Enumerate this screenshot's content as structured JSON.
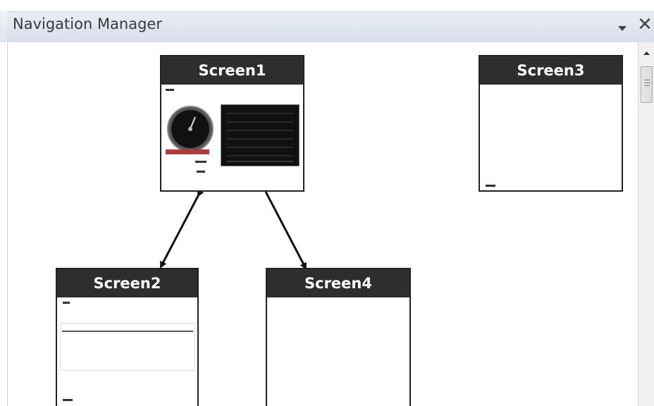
{
  "window": {
    "title": "Navigation Manager",
    "pin_icon": "dropdown-pin-icon",
    "close_glyph": "✕"
  },
  "screens": [
    {
      "id": "screen1",
      "label": "Screen1"
    },
    {
      "id": "screen2",
      "label": "Screen2"
    },
    {
      "id": "screen3",
      "label": "Screen3"
    },
    {
      "id": "screen4",
      "label": "Screen4"
    }
  ],
  "links": [
    {
      "from": "Screen1",
      "to": "Screen2",
      "direction": "both"
    },
    {
      "from": "Screen1",
      "to": "Screen4",
      "direction": "forward"
    }
  ],
  "colors": {
    "node_header": "#2e2e2e",
    "node_header_text": "#ffffff",
    "arrow": "#111111"
  }
}
